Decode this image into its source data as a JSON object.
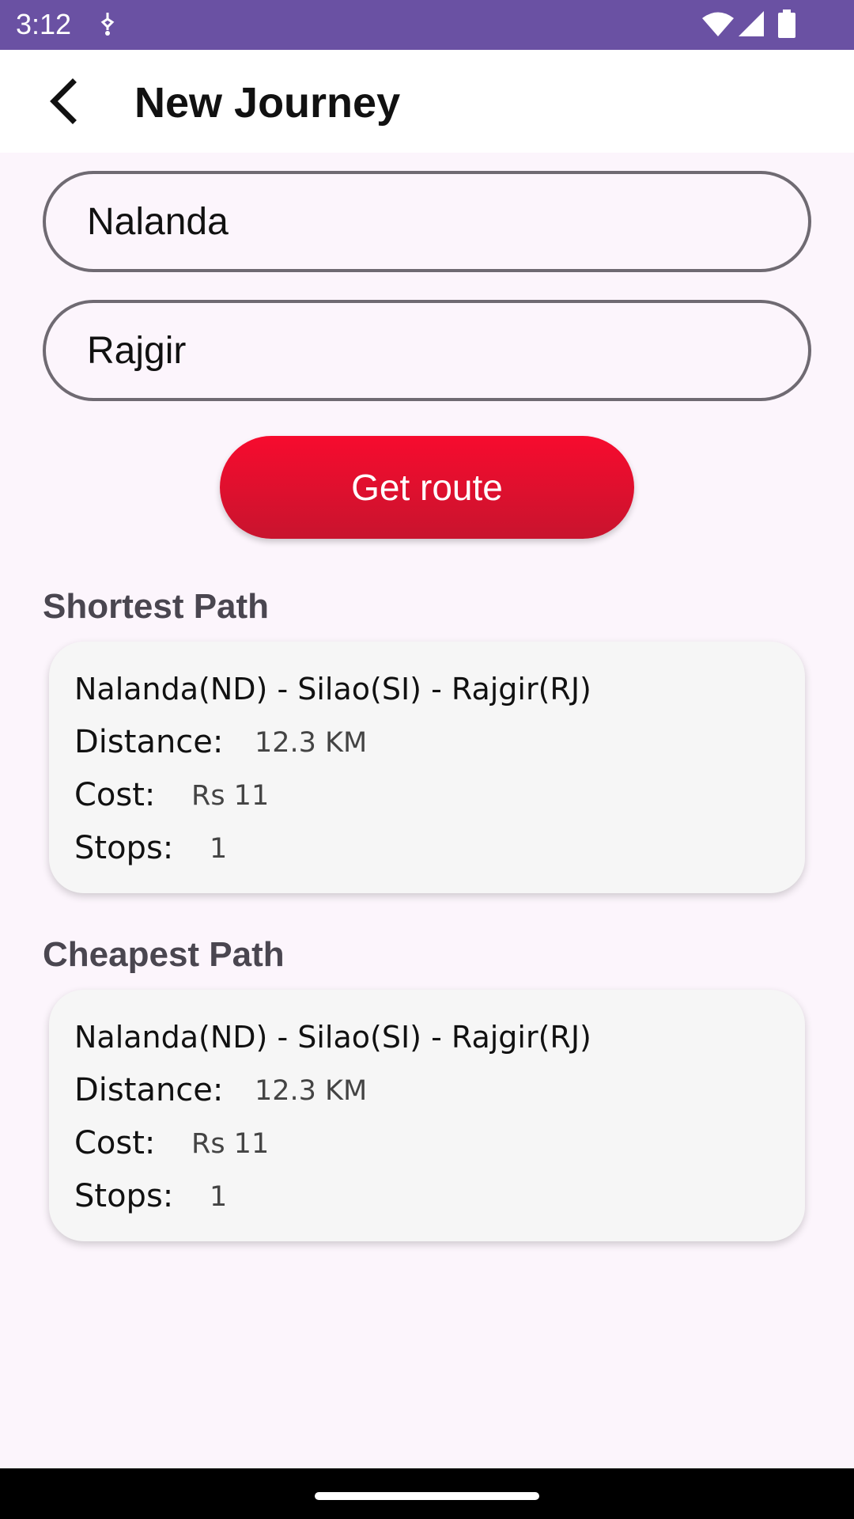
{
  "status_bar": {
    "time": "3:12",
    "background": "#6a51a3",
    "icons": [
      "notification-icon",
      "wifi-icon",
      "signal-icon",
      "battery-icon"
    ]
  },
  "app_bar": {
    "title": "New Journey",
    "back_icon": "back-arrow-icon"
  },
  "form": {
    "from_value": "Nalanda",
    "to_value": "Rajgir",
    "submit_label": "Get route",
    "accent": "#e8102e"
  },
  "shortest": {
    "heading": "Shortest Path",
    "route": "Nalanda(ND) - Silao(SI) - Rajgir(RJ)",
    "distance_label": "Distance:",
    "distance_value": "12.3 KM",
    "cost_label": "Cost:",
    "cost_value": "Rs 11",
    "stops_label": "Stops:",
    "stops_value": "1"
  },
  "cheapest": {
    "heading": "Cheapest Path",
    "route": "Nalanda(ND) - Silao(SI) - Rajgir(RJ)",
    "distance_label": "Distance:",
    "distance_value": "12.3 KM",
    "cost_label": "Cost:",
    "cost_value": "Rs 11",
    "stops_label": "Stops:",
    "stops_value": "1"
  }
}
